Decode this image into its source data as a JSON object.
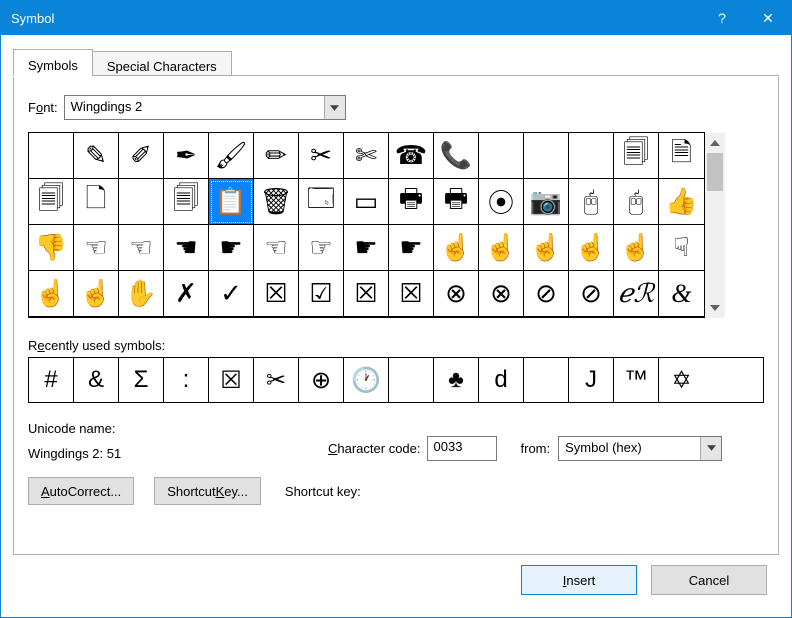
{
  "window": {
    "title": "Symbol",
    "help_glyph": "?",
    "close_glyph": "✕"
  },
  "tabs": [
    {
      "id": "symbols",
      "label": "Symbols",
      "active": true
    },
    {
      "id": "special",
      "label": "Special Characters",
      "active": false
    }
  ],
  "font": {
    "label_pre": "F",
    "label_u": "o",
    "label_post": "nt:",
    "value": "Wingdings 2"
  },
  "grid": {
    "selected_index": 19,
    "cells": [
      "",
      "✎",
      "✐",
      "✒",
      "🖌",
      "✏",
      "✂",
      "✄",
      "☎",
      "📞",
      "",
      "",
      "",
      "🗐",
      "🗎",
      "🗐",
      "🗋",
      "",
      "🗐",
      "📋",
      "🗑",
      "🗔",
      "▭",
      "🖶",
      "🖶",
      "⦿",
      "📷",
      "🖰",
      "🖰",
      "👍",
      "👎",
      "☜",
      "☜",
      "☚",
      "☛",
      "☜",
      "☞",
      "☛",
      "☛",
      "☝",
      "☝",
      "☝",
      "☝",
      "☝",
      "☟",
      "☝",
      "☝",
      "✋",
      "✗",
      "✓",
      "☒",
      "☑",
      "☒",
      "☒",
      "⊗",
      "⊗",
      "⊘",
      "⊘",
      "ℯℛ",
      "&"
    ],
    "cell_classes": {
      "58": "ampersand",
      "59": "ampersand"
    }
  },
  "recent": {
    "label_pre": "R",
    "label_u": "e",
    "label_post": "cently used symbols:",
    "cells": [
      "#",
      "&",
      "Σ",
      ":",
      "☒",
      "✂",
      "⊕",
      "🕐",
      "",
      "♣",
      "d",
      "",
      "J",
      "™",
      "✡"
    ]
  },
  "unicode": {
    "name_label": "Unicode name:",
    "value": "Wingdings 2: 51"
  },
  "charcode": {
    "label_u": "C",
    "label_post": "haracter code:",
    "value": "0033",
    "from_label": "from:",
    "from_value": "Symbol (hex)"
  },
  "buttons": {
    "autocorrect_u": "A",
    "autocorrect_post": "utoCorrect...",
    "shortcut_pre": "Shortcut ",
    "shortcut_u": "K",
    "shortcut_post": "ey...",
    "shortcut_label": "Shortcut key:"
  },
  "footer": {
    "insert_u": "I",
    "insert_post": "nsert",
    "cancel": "Cancel"
  }
}
